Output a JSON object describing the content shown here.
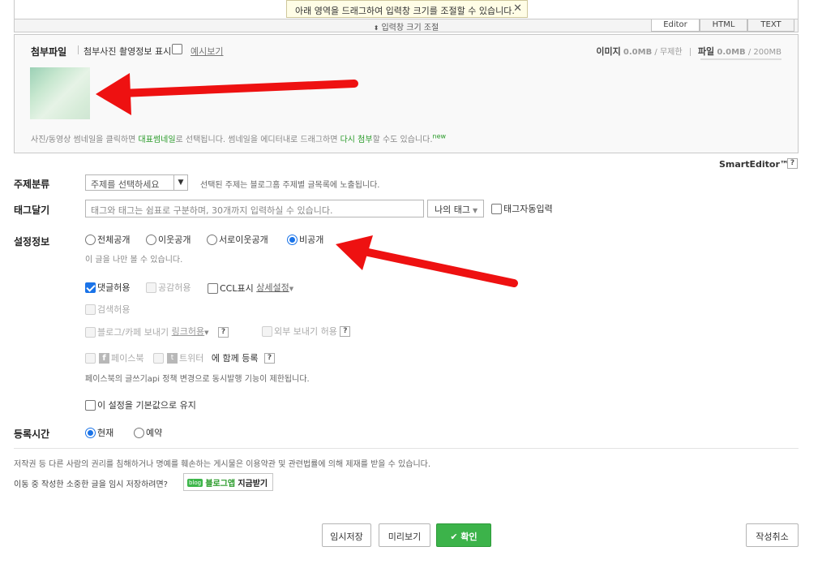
{
  "tooltip": {
    "text": "아래 영역을 드래그하여 입력창 크기를 조절할 수 있습니다.",
    "close": "✕"
  },
  "resize_bar": {
    "label": "입력창 크기 조절",
    "arrow": "⬍"
  },
  "mode_tabs": [
    "Editor",
    "HTML",
    "TEXT"
  ],
  "attach": {
    "title": "첨부파일",
    "exif_label": "첨부사진 촬영정보 표시",
    "example": "예시보기",
    "image_label": "이미지",
    "image_value": "0.0MB",
    "image_limit": "무제한",
    "file_label": "파일",
    "file_value": "0.0MB",
    "file_limit": "200MB",
    "desc_1": "사진/동영상 썸네일을 클릭하면 ",
    "desc_rep": "대표썸네일",
    "desc_2": "로 선택됩니다. 썸네일을 에디터내로 드래그하면 ",
    "desc_re": "다시 첨부",
    "desc_3": "할 수도 있습니다.",
    "desc_new": "new"
  },
  "smart_editor": "SmartEditor™",
  "topic": {
    "label": "주제분류",
    "select_value": "주제를 선택하세요",
    "help": "선택된 주제는 블로그홈 주제별 글목록에 노출됩니다."
  },
  "tags": {
    "label": "태그달기",
    "placeholder": "태그와 태그는 쉼표로 구분하며, 30개까지 입력하실 수 있습니다.",
    "my_tags": "나의 태그",
    "auto_label": "태그자동입력"
  },
  "settings": {
    "label": "설정정보",
    "visibility": [
      "전체공개",
      "이웃공개",
      "서로이웃공개",
      "비공개"
    ],
    "selected": 3,
    "visibility_help": "이 글을 나만 볼 수 있습니다.",
    "comment": "댓글허용",
    "sympathy": "공감허용",
    "ccl": "CCL표시",
    "ccl_detail": "상세설정",
    "search": "검색허용",
    "blog_cafe": "블로그/카페 보내기 ",
    "link_allow": "링크허용",
    "external": "외부 보내기 허용",
    "facebook": "페이스북",
    "twitter": "트위터",
    "share_together": "에 함께 등록",
    "fb_notice": "페이스북의 글쓰기api 정책 변경으로 동시발행 기능이 제한됩니다.",
    "keep_default": "이 설정을 기본값으로 유지"
  },
  "post_time": {
    "label": "등록시간",
    "now": "현재",
    "reserve": "예약"
  },
  "notice_copyright": "저작권 등 다른 사람의 권리를 침해하거나 명예를 훼손하는 게시물은 이용약관 및 관련법률에 의해 제재를 받을 수 있습니다.",
  "notice_app": "이동 중 작성한 소중한 글을 임시 저장하려면?",
  "app_button": {
    "badge": "blog",
    "app": "블로그앱",
    "get": "지금받기"
  },
  "buttons": {
    "temp_save": "임시저장",
    "preview": "미리보기",
    "confirm": "✔ 확인",
    "cancel": "작성취소"
  },
  "colors": {
    "accent_green": "#3cb34a",
    "arrow_red": "#ee1111",
    "radio_blue": "#1a73e8"
  }
}
